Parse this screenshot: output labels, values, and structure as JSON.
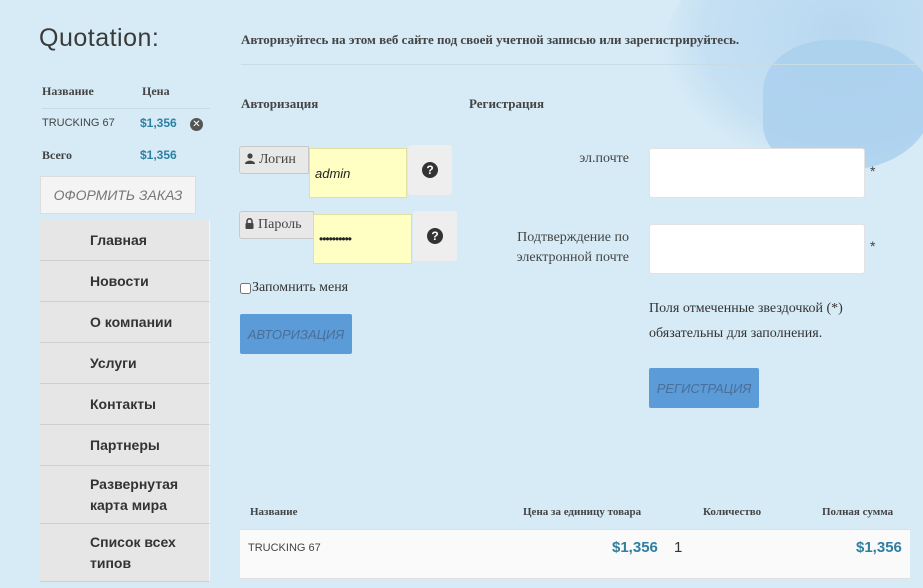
{
  "sidebar": {
    "title": "Quotation:",
    "columns": {
      "name": "Название",
      "price": "Цена"
    },
    "items": [
      {
        "name": "TRUCKING 67",
        "price": "$1,356"
      }
    ],
    "total_label": "Всего",
    "total_value": "$1,356",
    "order_button": "ОФОРМИТЬ ЗАКАЗ",
    "nav": [
      "Главная",
      "Новости",
      "О компании",
      "Услуги",
      "Контакты",
      "Партнеры",
      "Развернутая карта мира",
      "Список всех типов"
    ]
  },
  "main": {
    "heading": "Авторизуйтесь на этом веб сайте под своей учетной записью или зарегистрируйтесь.",
    "login": {
      "section_title": "Авторизация",
      "login_label": "Логин",
      "login_value": "admin",
      "password_label": "Пароль",
      "password_value": "••••••••••",
      "remember_label": "Запомнить меня",
      "submit": "АВТОРИЗАЦИЯ"
    },
    "register": {
      "section_title": "Регистрация",
      "email_label": "эл.почте",
      "confirm_label_1": "Подтверждение по",
      "confirm_label_2": "электронной почте",
      "required_star": "*",
      "note_line1": "Поля отмеченные звездочкой (*)",
      "note_line2": "обязательны для заполнения.",
      "submit": "РЕГИСТРАЦИЯ"
    }
  },
  "cart_table": {
    "headers": {
      "name": "Название",
      "unit_price": "Цена за единицу товара",
      "quantity": "Количество",
      "total": "Полная сумма"
    },
    "rows": [
      {
        "name": "TRUCKING 67",
        "unit_price": "$1,356",
        "quantity": "1",
        "total": "$1,356"
      }
    ]
  },
  "icons": {
    "user": "user-icon",
    "lock": "lock-icon",
    "help": "question-circle-icon",
    "remove": "remove-circle-icon"
  },
  "colors": {
    "background": "#d6ebf6",
    "price": "#2e7fa0",
    "button": "#5a9bd8",
    "autofill": "#ffffc4"
  }
}
